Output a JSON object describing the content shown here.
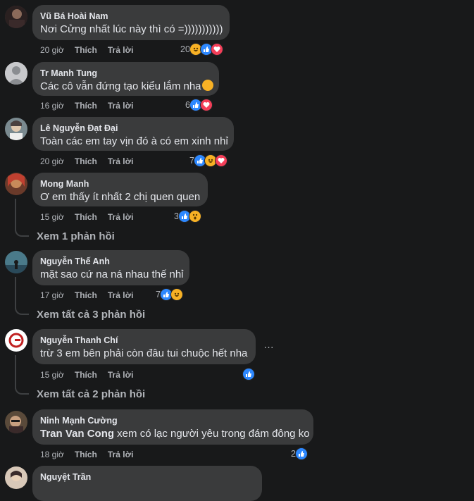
{
  "actions": {
    "like": "Thích",
    "reply": "Trả lời"
  },
  "comments": [
    {
      "name": "Vũ Bá Hoài Nam",
      "text": "Nơi Cửng nhất lúc này thì có =)))))))))))",
      "time": "20 giờ",
      "reactions": "20",
      "avatar_color": "#5a4a4a"
    },
    {
      "name": "Tr Manh Tung",
      "text": "Các cô vẫn đứng tạo kiểu lắm nha",
      "time": "16 giờ",
      "reactions": "6",
      "avatar_color": "#c8c9cc"
    },
    {
      "name": "Lê Nguyễn Đạt Đại",
      "text": "Toàn các em tay vịn đó à có em xinh nhỉ",
      "time": "20 giờ",
      "reactions": "7",
      "avatar_color": "#9aa6ad"
    },
    {
      "name": "Mong Manh",
      "text": "Ơ em thấy ít nhất 2 chị quen quen",
      "time": "15 giờ",
      "reactions": "3",
      "replies": "Xem 1 phản hồi",
      "avatar_color": "#8a5a3a"
    },
    {
      "name": "Nguyễn Thế Anh",
      "text": "mặt sao cứ na ná nhau thế nhỉ",
      "time": "17 giờ",
      "reactions": "7",
      "replies": "Xem tất cả 3 phản hồi",
      "avatar_color": "#3a6a7a"
    },
    {
      "name": "Nguyễn Thanh Chí",
      "text": "trừ 3 em bên phải còn đâu tui chuộc hết nha",
      "time": "15 giờ",
      "reactions": "",
      "replies": "Xem tất cả 2 phản hồi",
      "avatar_color": "#ffffff"
    },
    {
      "name": "Ninh Mạnh Cường",
      "mention": "Tran Van Cong",
      "text": " xem có lạc người yêu trong đám đông ko",
      "time": "18 giờ",
      "reactions": "2",
      "avatar_color": "#6a5a4a"
    },
    {
      "name": "Nguyệt Trần",
      "avatar_color": "#d8c8b8"
    }
  ],
  "more_icon": "…",
  "colors": {
    "background": "#18191a",
    "bubble": "#3a3b3c",
    "like": "#2d88ff",
    "love": "#f33e58",
    "haha": "#f7b125"
  }
}
